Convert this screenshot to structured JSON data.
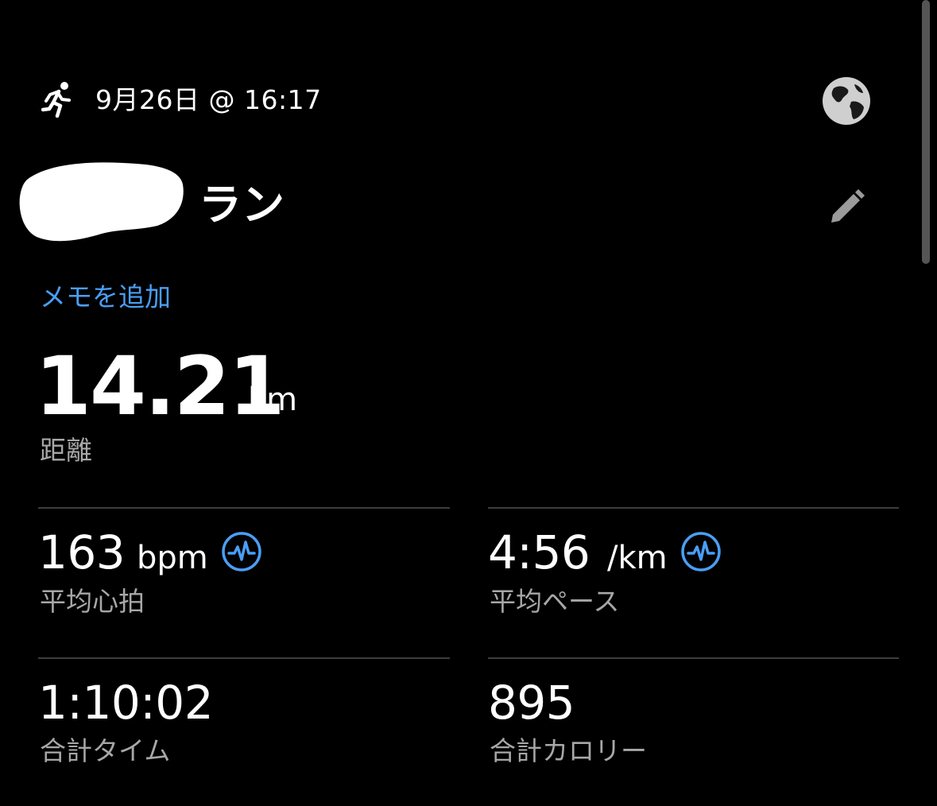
{
  "header": {
    "activity_icon": "running-person-icon",
    "date_time": "9月26日 @ 16:17",
    "map_icon": "globe-icon"
  },
  "activity": {
    "title_suffix": "ラン",
    "edit_icon": "pencil-icon",
    "add_memo_label": "メモを追加"
  },
  "distance": {
    "value": "14.21",
    "unit": "km",
    "label": "距離"
  },
  "stats": {
    "heart_rate": {
      "value": "163",
      "unit": "bpm",
      "label": "平均心拍",
      "icon": "heartbeat-icon"
    },
    "pace": {
      "value": "4:56",
      "unit": "/km",
      "label": "平均ペース",
      "icon": "heartbeat-icon"
    },
    "total_time": {
      "value": "1:10:02",
      "label": "合計タイム"
    },
    "calories": {
      "value": "895",
      "label": "合計カロリー"
    }
  },
  "colors": {
    "background": "#000000",
    "text": "#ffffff",
    "secondary_text": "#a7a7a7",
    "accent": "#4a9ef5",
    "divider": "#3d3d3d"
  }
}
